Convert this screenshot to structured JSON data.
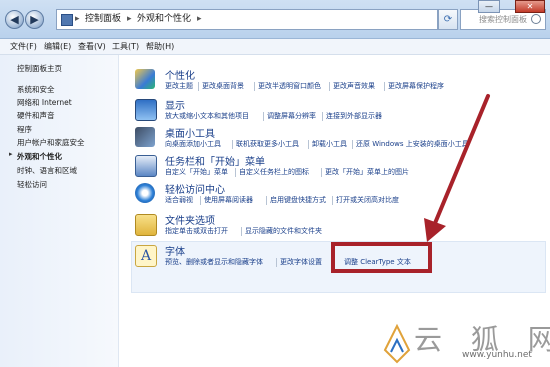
{
  "window": {
    "breadcrumb": [
      "控制面板",
      "外观和个性化"
    ],
    "search_placeholder": "搜索控制面板",
    "min_label": "—",
    "close_label": "✕"
  },
  "menu": [
    "文件(F)",
    "编辑(E)",
    "查看(V)",
    "工具(T)",
    "帮助(H)"
  ],
  "sidebar": {
    "home": "控制面板主页",
    "items": [
      "系统和安全",
      "网络和 Internet",
      "硬件和声音",
      "程序",
      "用户帐户和家庭安全",
      "外观和个性化",
      "时钟、语言和区域",
      "轻松访问"
    ],
    "current_index": 5
  },
  "categories": [
    {
      "title": "个性化",
      "icon": "personalization-icon",
      "links": [
        "更改主题",
        "更改桌面背景",
        "更改半透明窗口颜色",
        "更改声音效果",
        "更改屏幕保护程序"
      ]
    },
    {
      "title": "显示",
      "icon": "display-icon",
      "links": [
        "放大或缩小文本和其他项目",
        "调整屏幕分辨率",
        "连接到外部显示器"
      ]
    },
    {
      "title": "桌面小工具",
      "icon": "gadgets-icon",
      "links": [
        "向桌面添加小工具",
        "联机获取更多小工具",
        "卸载小工具",
        "还原 Windows 上安装的桌面小工具"
      ]
    },
    {
      "title": "任务栏和「开始」菜单",
      "icon": "taskbar-icon",
      "links": [
        "自定义「开始」菜单",
        "自定义任务栏上的图标",
        "更改「开始」菜单上的图片"
      ]
    },
    {
      "title": "轻松访问中心",
      "icon": "ease-of-access-icon",
      "links": [
        "适合弱视",
        "使用屏幕阅读器",
        "启用键盘快捷方式",
        "打开或关闭高对比度"
      ]
    },
    {
      "title": "文件夹选项",
      "icon": "folder-options-icon",
      "links": [
        "指定单击或双击打开",
        "显示隐藏的文件和文件夹"
      ]
    },
    {
      "title": "字体",
      "icon": "fonts-icon",
      "links": [
        "预览、删除或者显示和隐藏字体",
        "更改字体设置",
        "调整 ClearType 文本"
      ]
    }
  ],
  "watermark": {
    "brand": "云 狐 网",
    "url": "www.yunhu.net"
  },
  "colors": {
    "link": "#1a3f8a",
    "highlight": "#a8222a"
  }
}
